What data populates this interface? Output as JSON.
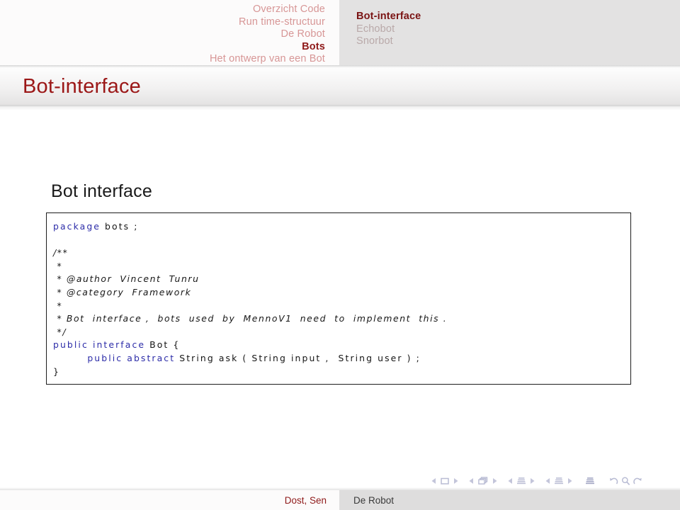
{
  "header": {
    "sections": [
      {
        "label": "Overzicht Code",
        "active": false
      },
      {
        "label": "Run time-structuur",
        "active": false
      },
      {
        "label": "De Robot",
        "active": false
      },
      {
        "label": "Bots",
        "active": true
      },
      {
        "label": "Het ontwerp van een Bot",
        "active": false
      }
    ],
    "subsections": [
      {
        "label": "Bot-interface",
        "active": true
      },
      {
        "label": "Echobot",
        "active": false
      },
      {
        "label": "Snorbot",
        "active": false
      }
    ]
  },
  "frame": {
    "title": "Bot-interface",
    "block_heading": "Bot interface"
  },
  "code": {
    "language": "java",
    "lines": [
      {
        "segments": [
          {
            "text": "package",
            "kind": "keyword"
          },
          {
            "text": " bots ;",
            "kind": "plain"
          }
        ],
        "comment": false
      },
      {
        "segments": [
          {
            "text": "",
            "kind": "plain"
          }
        ],
        "comment": false
      },
      {
        "segments": [
          {
            "text": "/**",
            "kind": "plain"
          }
        ],
        "comment": true
      },
      {
        "segments": [
          {
            "text": " *",
            "kind": "plain"
          }
        ],
        "comment": true
      },
      {
        "segments": [
          {
            "text": " * @author  Vincent  Tunru",
            "kind": "plain"
          }
        ],
        "comment": true
      },
      {
        "segments": [
          {
            "text": " * @category  Framework",
            "kind": "plain"
          }
        ],
        "comment": true
      },
      {
        "segments": [
          {
            "text": " *",
            "kind": "plain"
          }
        ],
        "comment": true
      },
      {
        "segments": [
          {
            "text": " * Bot  interface ,  bots  used  by  MennoV1  need  to  implement  this .",
            "kind": "plain"
          }
        ],
        "comment": true
      },
      {
        "segments": [
          {
            "text": " */",
            "kind": "plain"
          }
        ],
        "comment": true
      },
      {
        "segments": [
          {
            "text": "public",
            "kind": "keyword"
          },
          {
            "text": " ",
            "kind": "plain"
          },
          {
            "text": "interface",
            "kind": "keyword"
          },
          {
            "text": " Bot {",
            "kind": "plain"
          }
        ],
        "comment": false
      },
      {
        "segments": [
          {
            "text": "        ",
            "kind": "plain"
          },
          {
            "text": "public",
            "kind": "keyword"
          },
          {
            "text": " ",
            "kind": "plain"
          },
          {
            "text": "abstract",
            "kind": "keyword"
          },
          {
            "text": " String ask ( String input ,  String user ) ;",
            "kind": "plain"
          }
        ],
        "comment": false
      },
      {
        "segments": [
          {
            "text": "}",
            "kind": "plain"
          }
        ],
        "comment": false
      }
    ]
  },
  "footer": {
    "author": "Dost, Sen",
    "title": "De Robot"
  },
  "navigation_symbols": {
    "groups": [
      {
        "name": "slide",
        "icon": "slide-icon",
        "prev": "previous-slide",
        "next": "next-slide"
      },
      {
        "name": "frame",
        "icon": "frame-icon",
        "prev": "previous-frame",
        "next": "next-frame"
      },
      {
        "name": "subsection",
        "icon": "subsection-icon",
        "prev": "previous-subsection",
        "next": "next-subsection"
      },
      {
        "name": "section",
        "icon": "section-icon",
        "prev": "previous-section",
        "next": "next-section"
      }
    ],
    "presentation_icon": "presentation-icon",
    "seek": [
      "back-icon",
      "search-icon",
      "forward-icon"
    ]
  },
  "colors": {
    "accent_dark_red": "#8f1a1a",
    "title_red": "#9b1717",
    "inactive_section": "#d79696",
    "inactive_subsection": "#b9a9a9",
    "keyword_blue": "#2c2ca8",
    "header_right_bg": "#e3e2e2",
    "footer_right_bg": "#dedddd"
  }
}
